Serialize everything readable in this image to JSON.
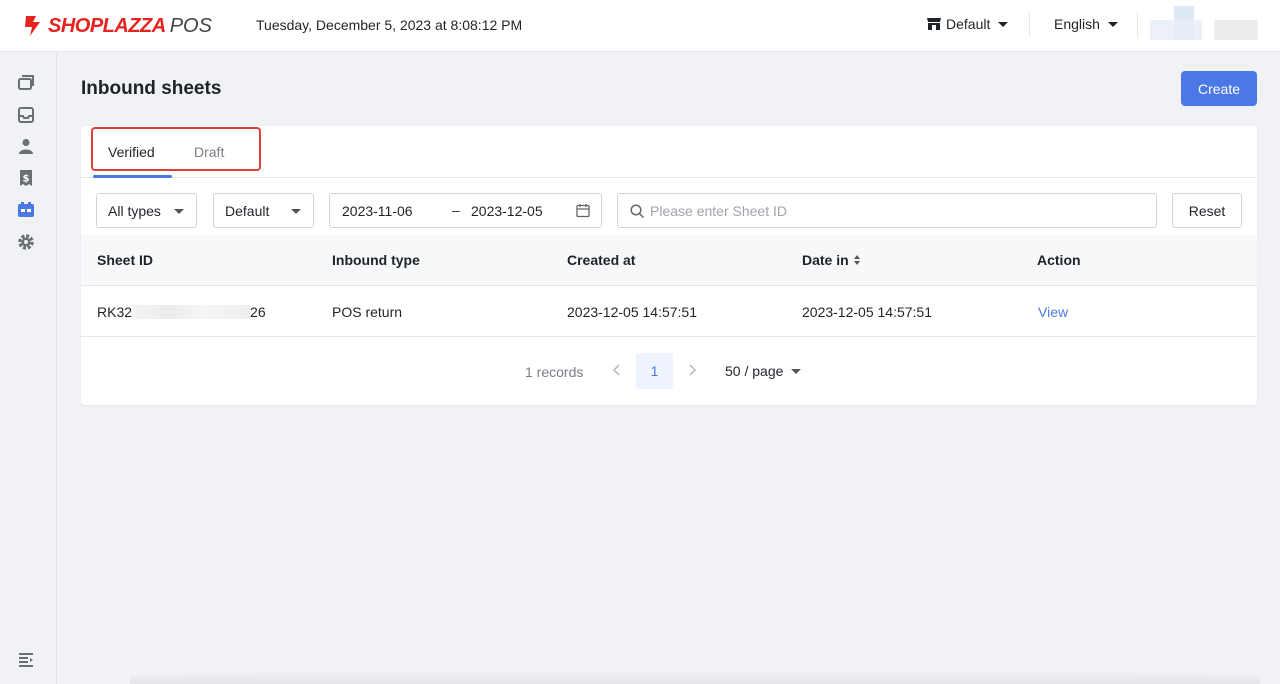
{
  "header": {
    "logo_text": "SHOPLAZZA",
    "logo_suffix": "POS",
    "datetime": "Tuesday, December 5, 2023 at 8:08:12 PM",
    "store": "Default",
    "language": "English"
  },
  "sidebar": {
    "items": [
      {
        "icon": "orders-icon"
      },
      {
        "icon": "inbox-icon"
      },
      {
        "icon": "user-icon"
      },
      {
        "icon": "receipt-dollar-icon"
      },
      {
        "icon": "inventory-icon",
        "active": true
      },
      {
        "icon": "gear-icon"
      }
    ],
    "bottom_icon": "collapse-menu-icon"
  },
  "page": {
    "title": "Inbound sheets",
    "create_label": "Create"
  },
  "tabs": [
    {
      "label": "Verified",
      "active": true
    },
    {
      "label": "Draft",
      "active": false
    }
  ],
  "filters": {
    "type": "All types",
    "store": "Default",
    "date_start": "2023-11-06",
    "date_sep": "–",
    "date_end": "2023-12-05",
    "search_placeholder": "Please enter Sheet ID",
    "reset_label": "Reset"
  },
  "table": {
    "columns": [
      "Sheet ID",
      "Inbound type",
      "Created at",
      "Date in",
      "Action"
    ],
    "rows": [
      {
        "sheet_id_prefix": "RK32",
        "sheet_id_suffix": "26",
        "inbound_type": "POS return",
        "created_at": "2023-12-05 14:57:51",
        "date_in": "2023-12-05 14:57:51",
        "action": "View"
      }
    ]
  },
  "pagination": {
    "records": "1 records",
    "current_page": "1",
    "page_size": "50 / page"
  },
  "colors": {
    "accent": "#4b78e6",
    "brand": "#e52420",
    "highlight": "#e0403a"
  }
}
